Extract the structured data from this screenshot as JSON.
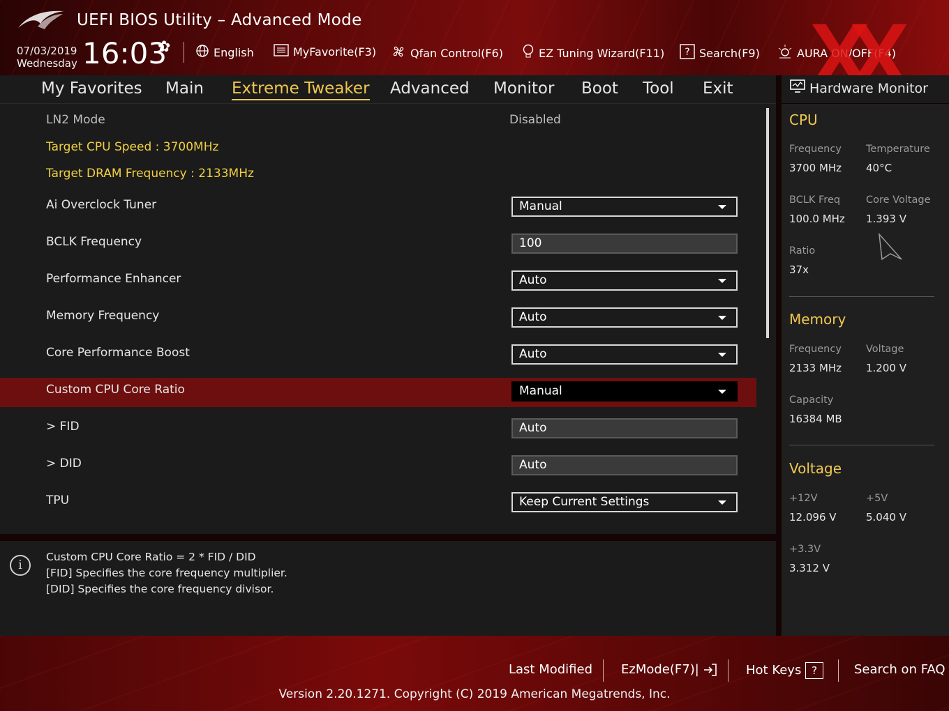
{
  "header": {
    "app_title": "UEFI BIOS Utility – Advanced Mode",
    "date": "07/03/2019",
    "weekday": "Wednesday",
    "time": "16:03",
    "toolbar": {
      "language": "English",
      "my_favorite": "MyFavorite(F3)",
      "qfan": "Qfan Control(F6)",
      "ez_tuning": "EZ Tuning Wizard(F11)",
      "search": "Search(F9)",
      "aura": "AURA ON/OFF(F4)"
    }
  },
  "tabs": [
    "My Favorites",
    "Main",
    "Extreme Tweaker",
    "Advanced",
    "Monitor",
    "Boot",
    "Tool",
    "Exit"
  ],
  "active_tab": "Extreme Tweaker",
  "main": {
    "ln2_label": "LN2 Mode",
    "ln2_value": "Disabled",
    "target_cpu": "Target CPU Speed : 3700MHz",
    "target_dram": "Target DRAM Frequency : 2133MHz",
    "settings": [
      {
        "label": "Ai Overclock Tuner",
        "value": "Manual",
        "type": "dropdown"
      },
      {
        "label": "BCLK Frequency",
        "value": "100",
        "type": "text"
      },
      {
        "label": "Performance Enhancer",
        "value": "Auto",
        "type": "dropdown"
      },
      {
        "label": "Memory Frequency",
        "value": "Auto",
        "type": "dropdown"
      },
      {
        "label": "Core Performance Boost",
        "value": "Auto",
        "type": "dropdown"
      },
      {
        "label": "Custom CPU Core Ratio",
        "value": "Manual",
        "type": "dropdown",
        "selected": true
      },
      {
        "label": "> FID",
        "value": "Auto",
        "type": "text"
      },
      {
        "label": "> DID",
        "value": "Auto",
        "type": "text"
      },
      {
        "label": "TPU",
        "value": "Keep Current Settings",
        "type": "dropdown"
      }
    ]
  },
  "info": {
    "lines": [
      "Custom CPU Core Ratio = 2 * FID / DID",
      "[FID] Specifies the core frequency multiplier.",
      "[DID] Specifies the core frequency divisor."
    ]
  },
  "hw_monitor": {
    "title": "Hardware Monitor",
    "cpu": {
      "heading": "CPU",
      "frequency_label": "Frequency",
      "frequency": "3700 MHz",
      "temperature_label": "Temperature",
      "temperature": "40°C",
      "bclk_label": "BCLK Freq",
      "bclk": "100.0 MHz",
      "core_voltage_label": "Core Voltage",
      "core_voltage": "1.393 V",
      "ratio_label": "Ratio",
      "ratio": "37x"
    },
    "memory": {
      "heading": "Memory",
      "frequency_label": "Frequency",
      "frequency": "2133 MHz",
      "voltage_label": "Voltage",
      "voltage": "1.200 V",
      "capacity_label": "Capacity",
      "capacity": "16384 MB"
    },
    "voltage": {
      "heading": "Voltage",
      "v12_label": "+12V",
      "v12": "12.096 V",
      "v5_label": "+5V",
      "v5": "5.040 V",
      "v33_label": "+3.3V",
      "v33": "3.312 V"
    }
  },
  "footer": {
    "last_modified": "Last Modified",
    "ezmode": "EzMode(F7)|",
    "hot_keys": "Hot Keys",
    "hot_keys_key": "?",
    "search_faq": "Search on FAQ",
    "version": "Version 2.20.1271. Copyright (C) 2019 American Megatrends, Inc."
  },
  "colors": {
    "accent": "#f0c850",
    "target_text": "#f0d040",
    "highlight_row": "#6e0f0f",
    "brand_red": "#7a0c0c"
  }
}
